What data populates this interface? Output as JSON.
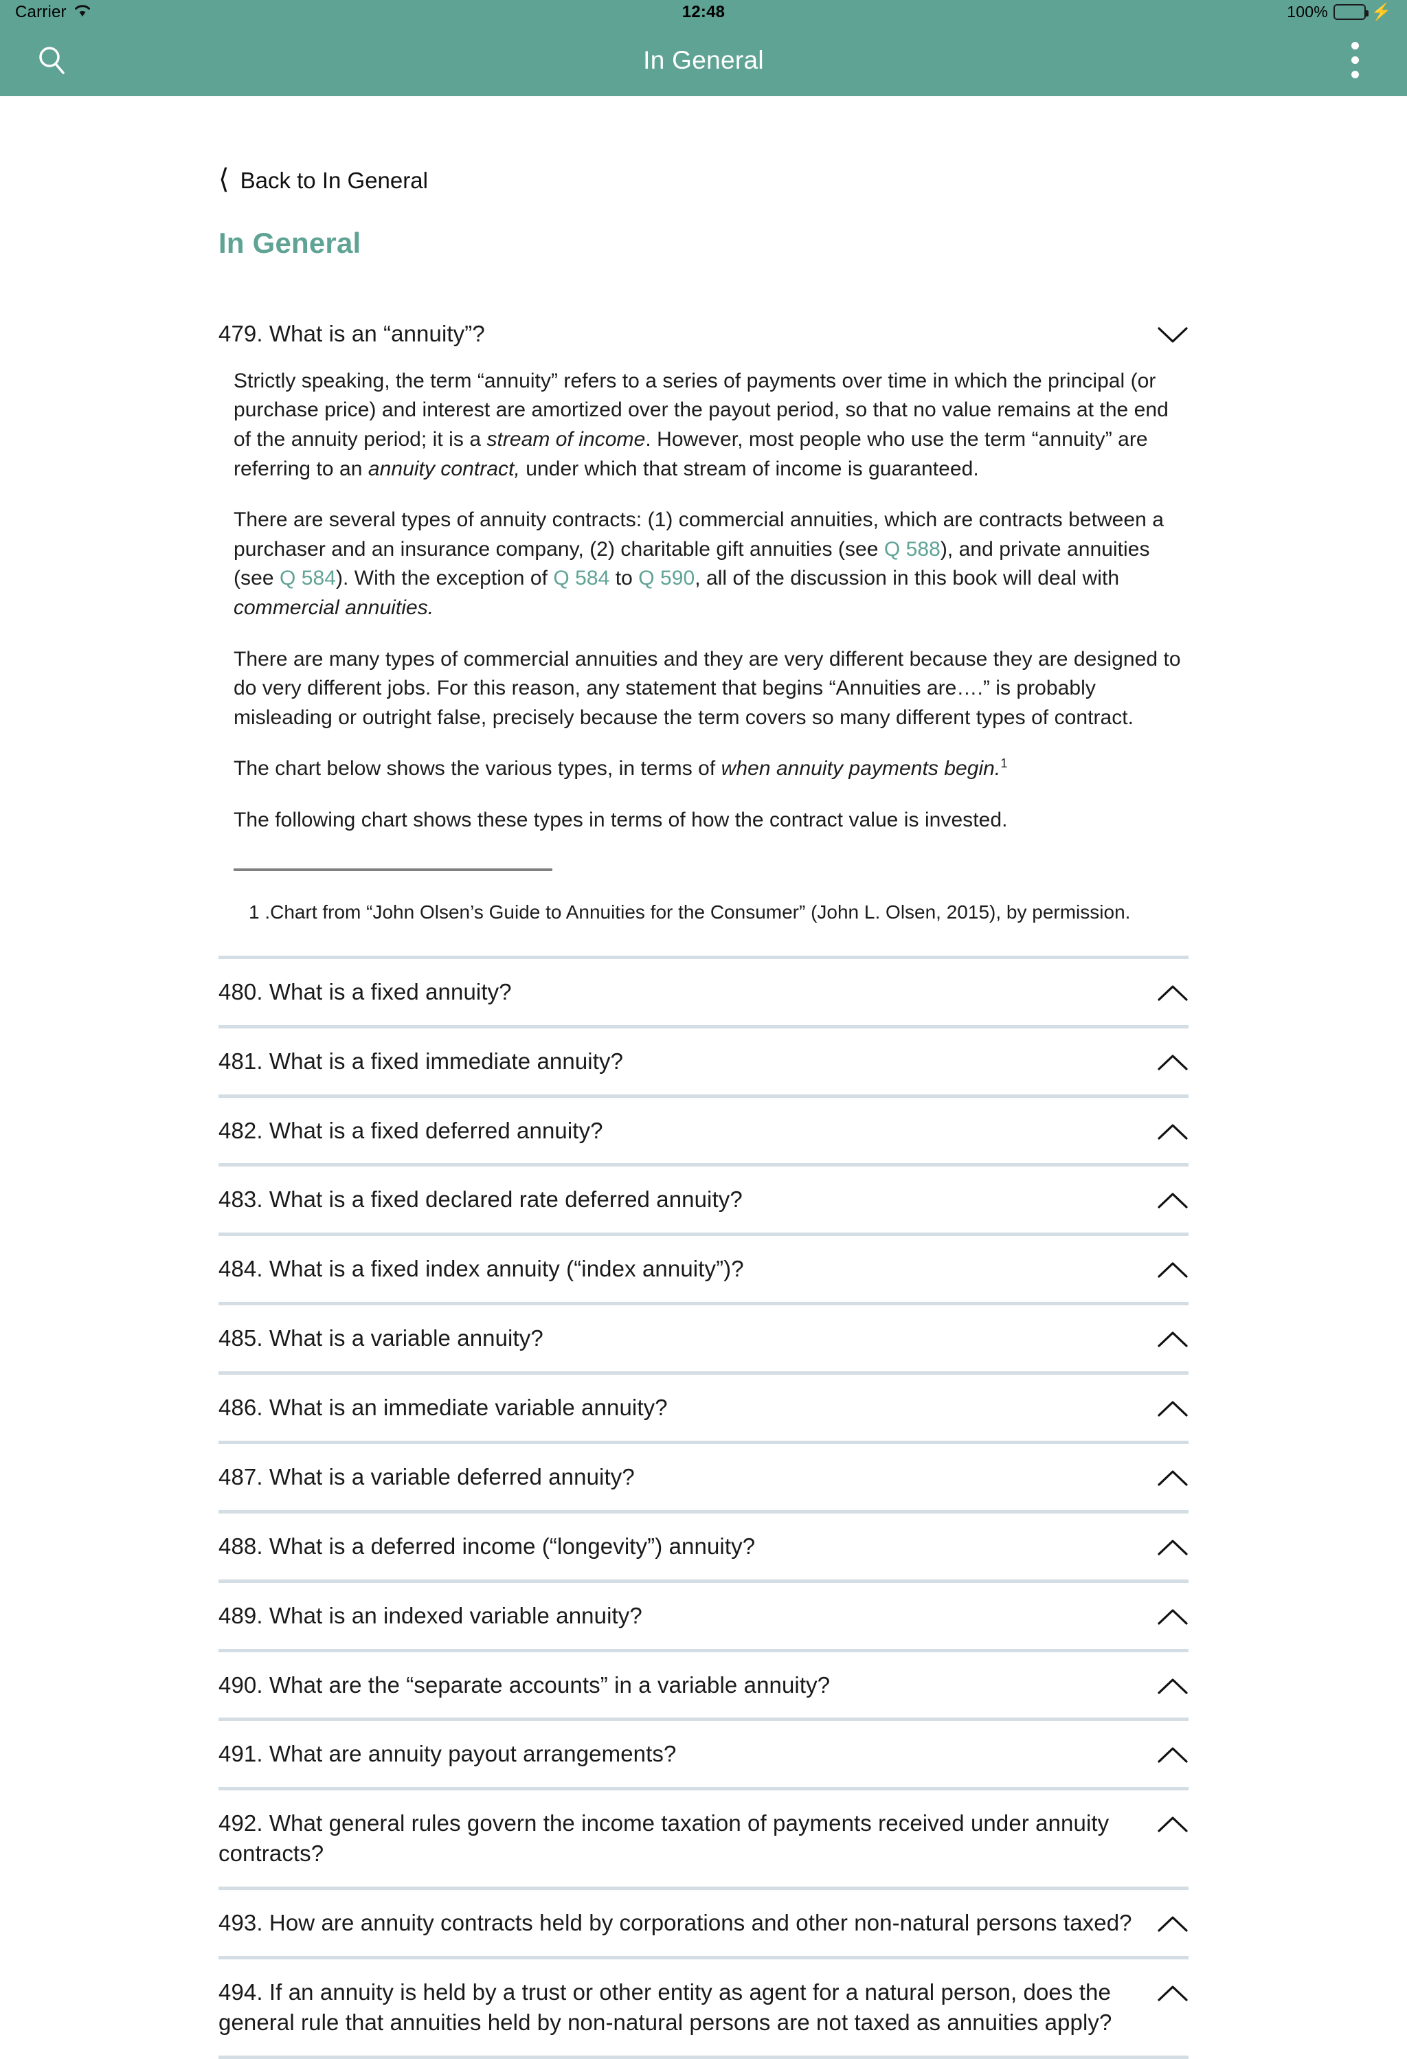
{
  "status_bar": {
    "carrier": "Carrier",
    "wifi_icon": "wifi-icon",
    "time": "12:48",
    "battery_percent": "100%",
    "battery_icon": "battery-icon",
    "charging_icon": "lightning-bolt-icon"
  },
  "nav_bar": {
    "search_icon": "search-icon",
    "title": "In General",
    "overflow_icon": "kebab-menu-icon"
  },
  "back_link": {
    "chevron_icon": "chevron-left-icon",
    "label": "Back to In General"
  },
  "page": {
    "heading": "In General",
    "accent_color": "#5FA395",
    "separator_color": "#D4DDE4",
    "link_color": "#5FA395"
  },
  "questions": [
    {
      "id": "479",
      "title": "479. What is an “annuity”?",
      "expanded": true,
      "chevron_icon": "chevron-down-icon",
      "body": {
        "paragraphs": [
          {
            "parts": [
              {
                "text": "Strictly speaking, the term “annuity” refers to a series of payments over time in which the principal (or purchase price) and interest are amortized over the payout period, so that no value remains at the end of the annuity period; it is a ",
                "style": "normal"
              },
              {
                "text": "stream of income",
                "style": "italic"
              },
              {
                "text": ". However, most people who use the term “annuity” are referring to an ",
                "style": "normal"
              },
              {
                "text": "annuity contract,",
                "style": "italic"
              },
              {
                "text": " under which that stream of income is guaranteed.",
                "style": "normal"
              }
            ]
          },
          {
            "parts": [
              {
                "text": "There are several types of annuity contracts: (1) commercial annuities, which are contracts between a purchaser and an insurance company, (2) charitable gift annuities (see ",
                "style": "normal"
              },
              {
                "text": "Q 588",
                "style": "link"
              },
              {
                "text": "), and private annuities (see ",
                "style": "normal"
              },
              {
                "text": "Q 584",
                "style": "link"
              },
              {
                "text": "). With the exception of ",
                "style": "normal"
              },
              {
                "text": "Q 584",
                "style": "link"
              },
              {
                "text": " to ",
                "style": "normal"
              },
              {
                "text": "Q 590",
                "style": "link"
              },
              {
                "text": ", all of the discussion in this book will deal with ",
                "style": "normal"
              },
              {
                "text": "commercial annuities.",
                "style": "italic"
              }
            ]
          },
          {
            "parts": [
              {
                "text": "There are many types of commercial annuities and they are very different because they are designed to do very different jobs. For this reason, any statement that begins “Annuities are….” is probably misleading or outright false, precisely because the term covers so many different types of contract.",
                "style": "normal"
              }
            ]
          },
          {
            "parts": [
              {
                "text": "The chart below shows the various types, in terms of ",
                "style": "normal"
              },
              {
                "text": "when annuity payments begin.",
                "style": "italic"
              },
              {
                "text": "1",
                "style": "superscript"
              }
            ]
          },
          {
            "parts": [
              {
                "text": "The following chart shows these types in terms of how the contract value is invested.",
                "style": "normal"
              }
            ]
          }
        ],
        "footnote": "1 .Chart from “John Olsen’s Guide to Annuities for the Consumer” (John L. Olsen, 2015), by permission."
      }
    },
    {
      "id": "480",
      "title": "480. What is a fixed annuity?",
      "expanded": false,
      "chevron_icon": "chevron-up-icon"
    },
    {
      "id": "481",
      "title": "481. What is a fixed immediate annuity?",
      "expanded": false,
      "chevron_icon": "chevron-up-icon"
    },
    {
      "id": "482",
      "title": "482. What is a fixed deferred annuity?",
      "expanded": false,
      "chevron_icon": "chevron-up-icon"
    },
    {
      "id": "483",
      "title": "483. What is a fixed declared rate deferred annuity?",
      "expanded": false,
      "chevron_icon": "chevron-up-icon"
    },
    {
      "id": "484",
      "title": "484. What is a fixed index annuity (“index annuity”)?",
      "expanded": false,
      "chevron_icon": "chevron-up-icon"
    },
    {
      "id": "485",
      "title": "485. What is a variable annuity?",
      "expanded": false,
      "chevron_icon": "chevron-up-icon"
    },
    {
      "id": "486",
      "title": "486. What is an immediate variable annuity?",
      "expanded": false,
      "chevron_icon": "chevron-up-icon"
    },
    {
      "id": "487",
      "title": "487. What is a variable deferred annuity?",
      "expanded": false,
      "chevron_icon": "chevron-up-icon"
    },
    {
      "id": "488",
      "title": "488. What is a deferred income (“longevity”) annuity?",
      "expanded": false,
      "chevron_icon": "chevron-up-icon"
    },
    {
      "id": "489",
      "title": "489. What is an indexed variable annuity?",
      "expanded": false,
      "chevron_icon": "chevron-up-icon"
    },
    {
      "id": "490",
      "title": "490. What are the “separate accounts” in a variable annuity?",
      "expanded": false,
      "chevron_icon": "chevron-up-icon"
    },
    {
      "id": "491",
      "title": "491. What are annuity payout arrangements?",
      "expanded": false,
      "chevron_icon": "chevron-up-icon"
    },
    {
      "id": "492",
      "title": "492. What general rules govern the income taxation of payments received under annuity contracts?",
      "expanded": false,
      "chevron_icon": "chevron-up-icon"
    },
    {
      "id": "493",
      "title": "493. How are annuity contracts held by corporations and other non-natural persons taxed?",
      "expanded": false,
      "chevron_icon": "chevron-up-icon"
    },
    {
      "id": "494",
      "title": "494. If an annuity is held by a trust or other entity as agent for a natural person, does the general rule that annuities held by non-natural persons are not taxed as annuities apply?",
      "expanded": false,
      "chevron_icon": "chevron-up-icon"
    }
  ]
}
